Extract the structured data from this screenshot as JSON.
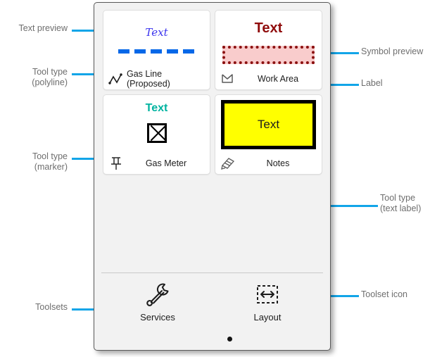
{
  "annotations": {
    "text_preview": "Text preview",
    "tool_type_polyline": "Tool type\n(polyline)",
    "tool_type_marker": "Tool type\n(marker)",
    "toolsets": "Toolsets",
    "symbol_preview": "Symbol preview",
    "label": "Label",
    "tool_type_text_label": "Tool type\n(text label)",
    "toolset_icon": "Toolset icon"
  },
  "panel": {
    "tools": [
      {
        "id": "gas-line-proposed",
        "preview_text": "Text",
        "preview_text_color": "#3a33ee",
        "label": "Gas Line (Proposed)",
        "icon_name": "polyline-icon",
        "symbol_color": "#0668e8",
        "symbol_kind": "dashed-line"
      },
      {
        "id": "work-area",
        "preview_text": "Text",
        "preview_text_color": "#8f0b0b",
        "label": "Work Area",
        "icon_name": "polygon-icon",
        "symbol_fill": "#f9cccc",
        "symbol_stroke": "#8c1212",
        "symbol_kind": "dotted-rectangle"
      },
      {
        "id": "gas-meter",
        "preview_text": "Text",
        "preview_text_color": "#00b3a0",
        "label": "Gas Meter",
        "icon_name": "pushpin-icon",
        "symbol_stroke": "#000000",
        "symbol_kind": "crossed-square"
      },
      {
        "id": "notes",
        "preview_text": "Text",
        "preview_text_color": "#1c1c1c",
        "label": "Notes",
        "icon_name": "note-pencil-icon",
        "symbol_fill": "#ffff00",
        "symbol_stroke": "#000000",
        "symbol_kind": "filled-rectangle"
      }
    ],
    "toolsets": [
      {
        "id": "services",
        "label": "Services",
        "icon_name": "wrench-icon"
      },
      {
        "id": "layout",
        "label": "Layout",
        "icon_name": "layout-arrows-icon"
      }
    ],
    "page_indicator": {
      "pages": 1,
      "active": 0
    }
  },
  "colors": {
    "accent": "#12a5e8",
    "annotation_text": "#6e6e6e",
    "panel_bg": "#f2f2f2",
    "card_bg": "#ffffff"
  }
}
